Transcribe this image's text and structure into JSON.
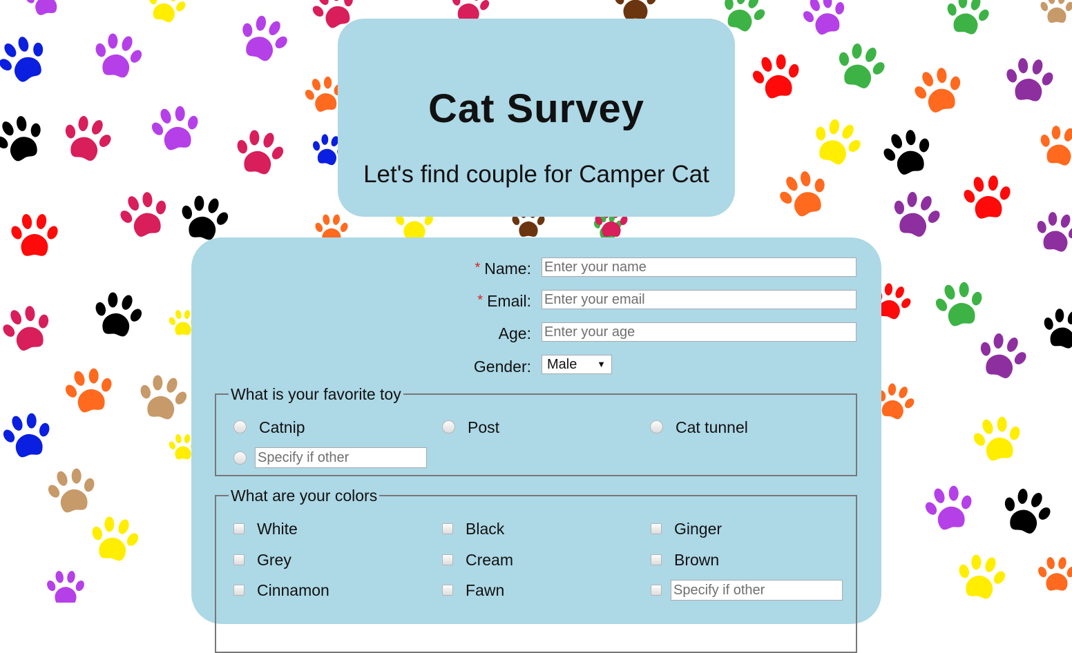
{
  "header": {
    "title": "Cat Survey",
    "subtitle": "Let's find couple for Camper Cat"
  },
  "form": {
    "required_mark": "*",
    "name": {
      "label": "Name:",
      "placeholder": "Enter your name"
    },
    "email": {
      "label": "Email:",
      "placeholder": "Enter your email"
    },
    "age": {
      "label": "Age:",
      "placeholder": "Enter your age"
    },
    "gender": {
      "label": "Gender:",
      "selected": "Male",
      "arrow": "▼"
    },
    "toy": {
      "legend": "What is your favorite toy",
      "options": [
        "Catnip",
        "Post",
        "Cat tunnel"
      ],
      "other_placeholder": "Specify if other"
    },
    "colors": {
      "legend": "What are your colors",
      "options": [
        "White",
        "Black",
        "Ginger",
        "Grey",
        "Cream",
        "Brown",
        "Cinnamon",
        "Fawn"
      ],
      "other_placeholder": "Specify if other"
    }
  },
  "colors": {
    "card_background": "#add8e6",
    "required": "#d9231f",
    "paw_colors": [
      "#0b1fe0",
      "#b540e8",
      "#d81e5b",
      "#ff0a0a",
      "#000000",
      "#ff6a1f",
      "#ffee00",
      "#3db346",
      "#c79a6a",
      "#8e2fa0",
      "#6b3510"
    ]
  }
}
